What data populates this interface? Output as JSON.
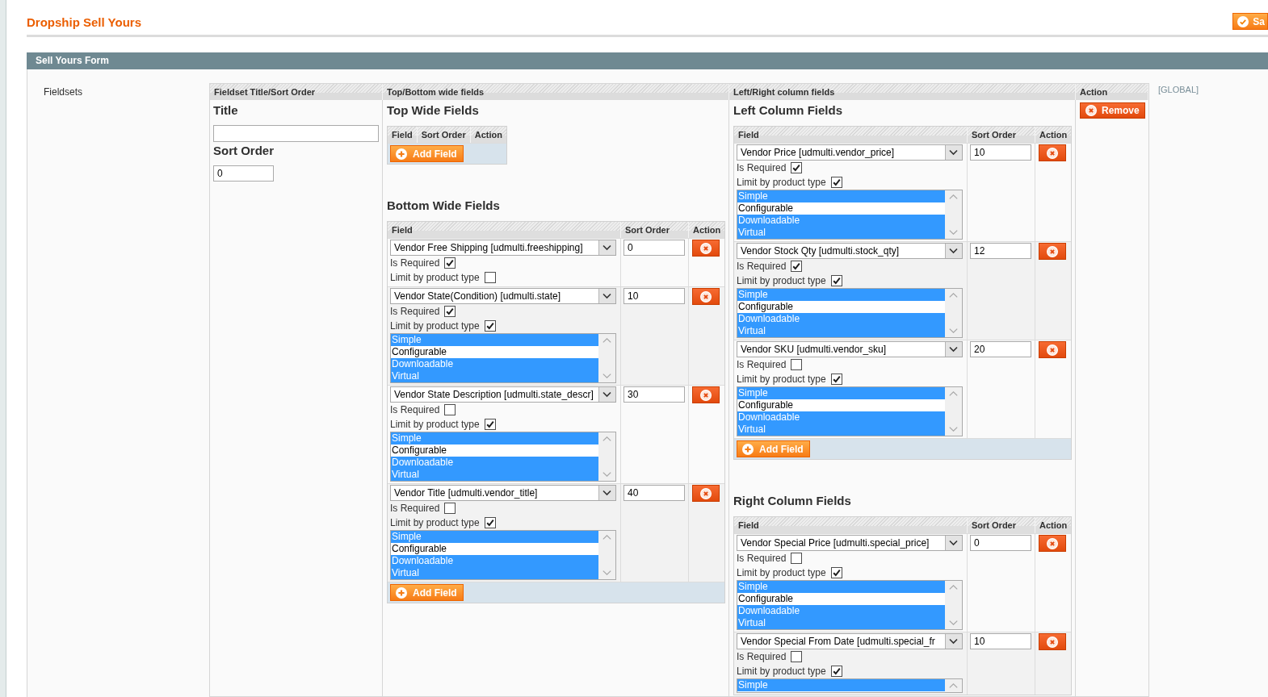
{
  "header": {
    "title": "Dropship Sell Yours",
    "save_button": "Sa"
  },
  "section": {
    "title": "Sell Yours Form"
  },
  "form": {
    "label": "Fieldsets",
    "columns": [
      "Fieldset Title/Sort Order",
      "Top/Bottom wide fields",
      "Left/Right column fields",
      "Action"
    ],
    "fieldset": {
      "title_label": "Title",
      "sort_label": "Sort Order",
      "sort_order": "0"
    },
    "groups": [
      {
        "tables": [
          {
            "heading": "Top Wide Fields",
            "columns": [
              "Field",
              "Sort Order",
              "Action"
            ],
            "add_button": "Add Field"
          },
          {
            "heading": "Bottom Wide Fields",
            "columns": [
              "Field",
              "Sort Order",
              "Action"
            ],
            "rows": [
              {
                "field": "Vendor Free Shipping [udmulti.freeshipping]",
                "required_label": "Is Required",
                "required": true,
                "limit_label": "Limit by product type",
                "limit": false,
                "sort_order": "0"
              },
              {
                "field": "Vendor State(Condition) [udmulti.state]",
                "required_label": "Is Required",
                "required": true,
                "limit_label": "Limit by product type",
                "limit": true,
                "product_types": [
                  {
                    "label": "Simple",
                    "selected": true
                  },
                  {
                    "label": "Configurable",
                    "selected": false
                  },
                  {
                    "label": "Downloadable",
                    "selected": true
                  },
                  {
                    "label": "Virtual",
                    "selected": true
                  }
                ],
                "sort_order": "10"
              },
              {
                "field": "Vendor State Description [udmulti.state_descr]",
                "required_label": "Is Required",
                "required": false,
                "limit_label": "Limit by product type",
                "limit": true,
                "product_types": [
                  {
                    "label": "Simple",
                    "selected": true
                  },
                  {
                    "label": "Configurable",
                    "selected": false
                  },
                  {
                    "label": "Downloadable",
                    "selected": true
                  },
                  {
                    "label": "Virtual",
                    "selected": true
                  }
                ],
                "sort_order": "30"
              },
              {
                "field": "Vendor Title [udmulti.vendor_title]",
                "required_label": "Is Required",
                "required": false,
                "limit_label": "Limit by product type",
                "limit": true,
                "product_types": [
                  {
                    "label": "Simple",
                    "selected": true
                  },
                  {
                    "label": "Configurable",
                    "selected": false
                  },
                  {
                    "label": "Downloadable",
                    "selected": true
                  },
                  {
                    "label": "Virtual",
                    "selected": true
                  }
                ],
                "sort_order": "40"
              }
            ],
            "add_button": "Add Field"
          }
        ]
      },
      {
        "tables": [
          {
            "heading": "Left Column Fields",
            "columns": [
              "Field",
              "Sort Order",
              "Action"
            ],
            "rows": [
              {
                "field": "Vendor Price [udmulti.vendor_price]",
                "required_label": "Is Required",
                "required": true,
                "limit_label": "Limit by product type",
                "limit": true,
                "product_types": [
                  {
                    "label": "Simple",
                    "selected": true
                  },
                  {
                    "label": "Configurable",
                    "selected": false
                  },
                  {
                    "label": "Downloadable",
                    "selected": true
                  },
                  {
                    "label": "Virtual",
                    "selected": true
                  }
                ],
                "sort_order": "10"
              },
              {
                "field": "Vendor Stock Qty [udmulti.stock_qty]",
                "required_label": "Is Required",
                "required": true,
                "limit_label": "Limit by product type",
                "limit": true,
                "product_types": [
                  {
                    "label": "Simple",
                    "selected": true
                  },
                  {
                    "label": "Configurable",
                    "selected": false
                  },
                  {
                    "label": "Downloadable",
                    "selected": true
                  },
                  {
                    "label": "Virtual",
                    "selected": true
                  }
                ],
                "sort_order": "12"
              },
              {
                "field": "Vendor SKU [udmulti.vendor_sku]",
                "required_label": "Is Required",
                "required": false,
                "limit_label": "Limit by product type",
                "limit": true,
                "product_types": [
                  {
                    "label": "Simple",
                    "selected": true
                  },
                  {
                    "label": "Configurable",
                    "selected": false
                  },
                  {
                    "label": "Downloadable",
                    "selected": true
                  },
                  {
                    "label": "Virtual",
                    "selected": true
                  }
                ],
                "sort_order": "20"
              }
            ],
            "add_button": "Add Field"
          },
          {
            "heading": "Right Column Fields",
            "columns": [
              "Field",
              "Sort Order",
              "Action"
            ],
            "rows": [
              {
                "field": "Vendor Special Price [udmulti.special_price]",
                "required_label": "Is Required",
                "required": false,
                "limit_label": "Limit by product type",
                "limit": true,
                "product_types": [
                  {
                    "label": "Simple",
                    "selected": true
                  },
                  {
                    "label": "Configurable",
                    "selected": false
                  },
                  {
                    "label": "Downloadable",
                    "selected": true
                  },
                  {
                    "label": "Virtual",
                    "selected": true
                  }
                ],
                "sort_order": "0"
              },
              {
                "field": "Vendor Special From Date [udmulti.special_fr",
                "required_label": "Is Required",
                "required": false,
                "limit_label": "Limit by product type",
                "limit": true,
                "product_types": [
                  {
                    "label": "Simple",
                    "selected": true
                  }
                ],
                "sort_order": "10"
              }
            ]
          }
        ]
      }
    ],
    "remove_button": "Remove",
    "scope": "[GLOBAL]"
  }
}
